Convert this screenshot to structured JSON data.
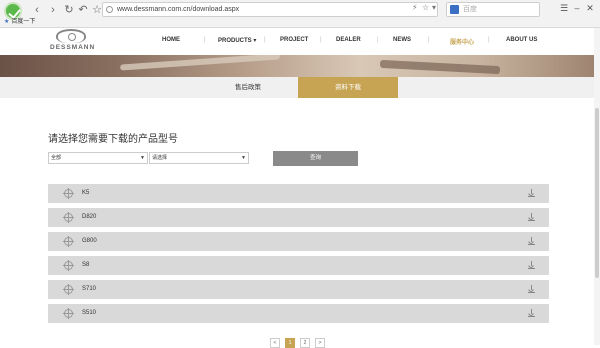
{
  "browser": {
    "url": "www.dessmann.com.cn/download.aspx",
    "search_placeholder": "百度",
    "bookmark": "百度一下",
    "back_icon": "back-icon",
    "forward_icon": "forward-icon"
  },
  "site": {
    "logo_text": "DESSMANN",
    "nav": [
      {
        "label": "HOME"
      },
      {
        "label": "PRODUCTS ▾"
      },
      {
        "label": "PROJECT"
      },
      {
        "label": "DEALER"
      },
      {
        "label": "NEWS"
      },
      {
        "label": "服务中心"
      },
      {
        "label": "ABOUT US"
      }
    ]
  },
  "tabs": [
    {
      "label": "售后政策"
    },
    {
      "label": "资料下载"
    }
  ],
  "page_title": "请选择您需要下载的产品型号",
  "filters": {
    "select1": "全部",
    "select2": "请选择",
    "query_button": "查询"
  },
  "products": [
    {
      "name": "K5"
    },
    {
      "name": "D820"
    },
    {
      "name": "G800"
    },
    {
      "name": "S8"
    },
    {
      "name": "S710"
    },
    {
      "name": "S510"
    }
  ],
  "pagination": {
    "prev": "<",
    "pages": [
      "1",
      "2"
    ],
    "next": ">"
  },
  "colors": {
    "accent": "#c7a454",
    "row_bg": "#d9d9d9",
    "button_gray": "#8a8a8a"
  }
}
